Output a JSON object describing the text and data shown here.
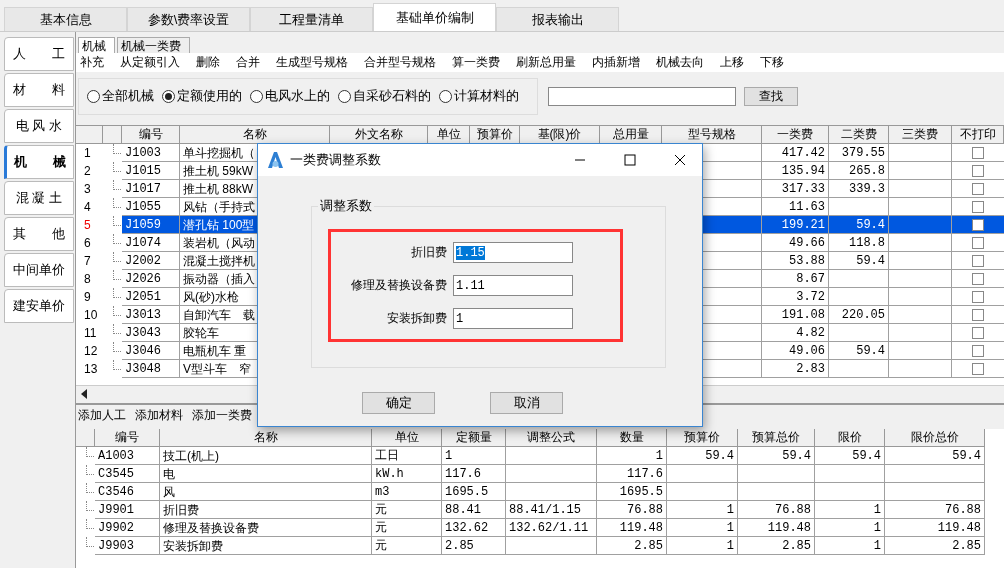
{
  "tabs": [
    {
      "label": "基本信息",
      "selected": false
    },
    {
      "label": "参数\\费率设置",
      "selected": false
    },
    {
      "label": "工程量清单",
      "selected": false
    },
    {
      "label": "基础单价编制",
      "selected": true
    },
    {
      "label": "报表输出",
      "selected": false
    }
  ],
  "side_tabs": [
    {
      "label": "人　　工",
      "selected": false
    },
    {
      "label": "材　　料",
      "selected": false
    },
    {
      "label": "电 风 水",
      "selected": false
    },
    {
      "label": "机　　械",
      "selected": true
    },
    {
      "label": "混 凝 土",
      "selected": false
    },
    {
      "label": "其　　他",
      "selected": false
    },
    {
      "label": "中间单价",
      "selected": false
    },
    {
      "label": "建安单价",
      "selected": false
    }
  ],
  "sub_tabs": [
    {
      "label": "机械",
      "selected": true
    },
    {
      "label": "机械一类费",
      "selected": false
    }
  ],
  "toolbar": [
    "补充",
    "从定额引入",
    "删除",
    "合并",
    "生成型号规格",
    "合并型号规格",
    "算一类费",
    "刷新总用量",
    "内插新增",
    "机械去向",
    "上移",
    "下移"
  ],
  "filters": [
    {
      "label": "全部机械",
      "selected": false
    },
    {
      "label": "定额使用的",
      "selected": true
    },
    {
      "label": "电风水上的",
      "selected": false
    },
    {
      "label": "自采砂石料的",
      "selected": false
    },
    {
      "label": "计算材料的",
      "selected": false
    }
  ],
  "search": {
    "button": "查找"
  },
  "machine_table": {
    "columns": [
      "编号",
      "名称",
      "外文名称",
      "单位",
      "预算价",
      "基(限)价",
      "总用量",
      "型号规格",
      "一类费",
      "二类费",
      "三类费",
      "不打印"
    ],
    "rows": [
      {
        "num": "1",
        "code": "J1003",
        "name": "单斗挖掘机（",
        "fee1": "417.42",
        "fee2": "379.55",
        "no_print": false,
        "selected": false
      },
      {
        "num": "2",
        "code": "J1015",
        "name": "推土机 59kW",
        "fee1": "135.94",
        "fee2": "265.8",
        "no_print": false,
        "selected": false
      },
      {
        "num": "3",
        "code": "J1017",
        "name": "推土机 88kW",
        "fee1": "317.33",
        "fee2": "339.3",
        "no_print": false,
        "selected": false
      },
      {
        "num": "4",
        "code": "J1055",
        "name": "风钻（手持式",
        "fee1": "11.63",
        "no_print": false,
        "selected": false
      },
      {
        "num": "5",
        "code": "J1059",
        "name": "潜孔钻 100型",
        "fee1": "199.21",
        "fee2": "59.4",
        "no_print": false,
        "selected": true
      },
      {
        "num": "6",
        "code": "J1074",
        "name": "装岩机（风动",
        "fee1": "49.66",
        "fee2": "118.8",
        "no_print": false,
        "selected": false
      },
      {
        "num": "7",
        "code": "J2002",
        "name": "混凝土搅拌机",
        "fee1": "53.88",
        "fee2": "59.4",
        "no_print": false,
        "selected": false
      },
      {
        "num": "8",
        "code": "J2026",
        "name": "振动器（插入",
        "fee1": "8.67",
        "no_print": false,
        "selected": false
      },
      {
        "num": "9",
        "code": "J2051",
        "name": "风(砂)水枪",
        "fee1": "3.72",
        "no_print": false,
        "selected": false
      },
      {
        "num": "10",
        "code": "J3013",
        "name": "自卸汽车　载",
        "fee1": "191.08",
        "fee2": "220.05",
        "no_print": false,
        "selected": false
      },
      {
        "num": "11",
        "code": "J3043",
        "name": "胶轮车",
        "fee1": "4.82",
        "no_print": false,
        "selected": false
      },
      {
        "num": "12",
        "code": "J3046",
        "name": "电瓶机车 重",
        "fee1": "49.06",
        "fee2": "59.4",
        "no_print": false,
        "selected": false
      },
      {
        "num": "13",
        "code": "J3048",
        "name": "V型斗车　窄",
        "fee1": "2.83",
        "no_print": false,
        "selected": false
      }
    ]
  },
  "bottom_toolbar": [
    "添加人工",
    "添加材料",
    "添加一类费"
  ],
  "detail_table": {
    "columns": [
      "编号",
      "名称",
      "单位",
      "定额量",
      "调整公式",
      "数量",
      "预算价",
      "预算总价",
      "限价",
      "限价总价"
    ],
    "rows": [
      {
        "code": "A1003",
        "name": "技工(机上)",
        "unit": "工日",
        "quota": "1",
        "qty": "1",
        "price": "59.4",
        "total": "59.4",
        "limit": "59.4",
        "limit_total": "59.4"
      },
      {
        "code": "C3545",
        "name": "电",
        "unit": "kW.h",
        "quota": "117.6",
        "qty": "117.6"
      },
      {
        "code": "C3546",
        "name": "风",
        "unit": "m3",
        "quota": "1695.5",
        "qty": "1695.5"
      },
      {
        "code": "J9901",
        "name": "折旧费",
        "unit": "元",
        "quota": "88.41",
        "formula": "88.41/1.15",
        "qty": "76.88",
        "price": "1",
        "total": "76.88",
        "limit": "1",
        "limit_total": "76.88"
      },
      {
        "code": "J9902",
        "name": "修理及替换设备费",
        "unit": "元",
        "quota": "132.62",
        "formula": "132.62/1.11",
        "qty": "119.48",
        "price": "1",
        "total": "119.48",
        "limit": "1",
        "limit_total": "119.48"
      },
      {
        "code": "J9903",
        "name": "安装拆卸费",
        "unit": "元",
        "quota": "2.85",
        "qty": "2.85",
        "price": "1",
        "total": "2.85",
        "limit": "1",
        "limit_total": "2.85"
      }
    ]
  },
  "dialog": {
    "title": "一类费调整系数",
    "group": "调整系数",
    "fields": [
      {
        "label": "折旧费",
        "value": "1.15",
        "highlighted": true
      },
      {
        "label": "修理及替换设备费",
        "value": "1.11",
        "highlighted": false
      },
      {
        "label": "安装拆卸费",
        "value": "1",
        "highlighted": false
      }
    ],
    "buttons": [
      "确定",
      "取消"
    ]
  }
}
